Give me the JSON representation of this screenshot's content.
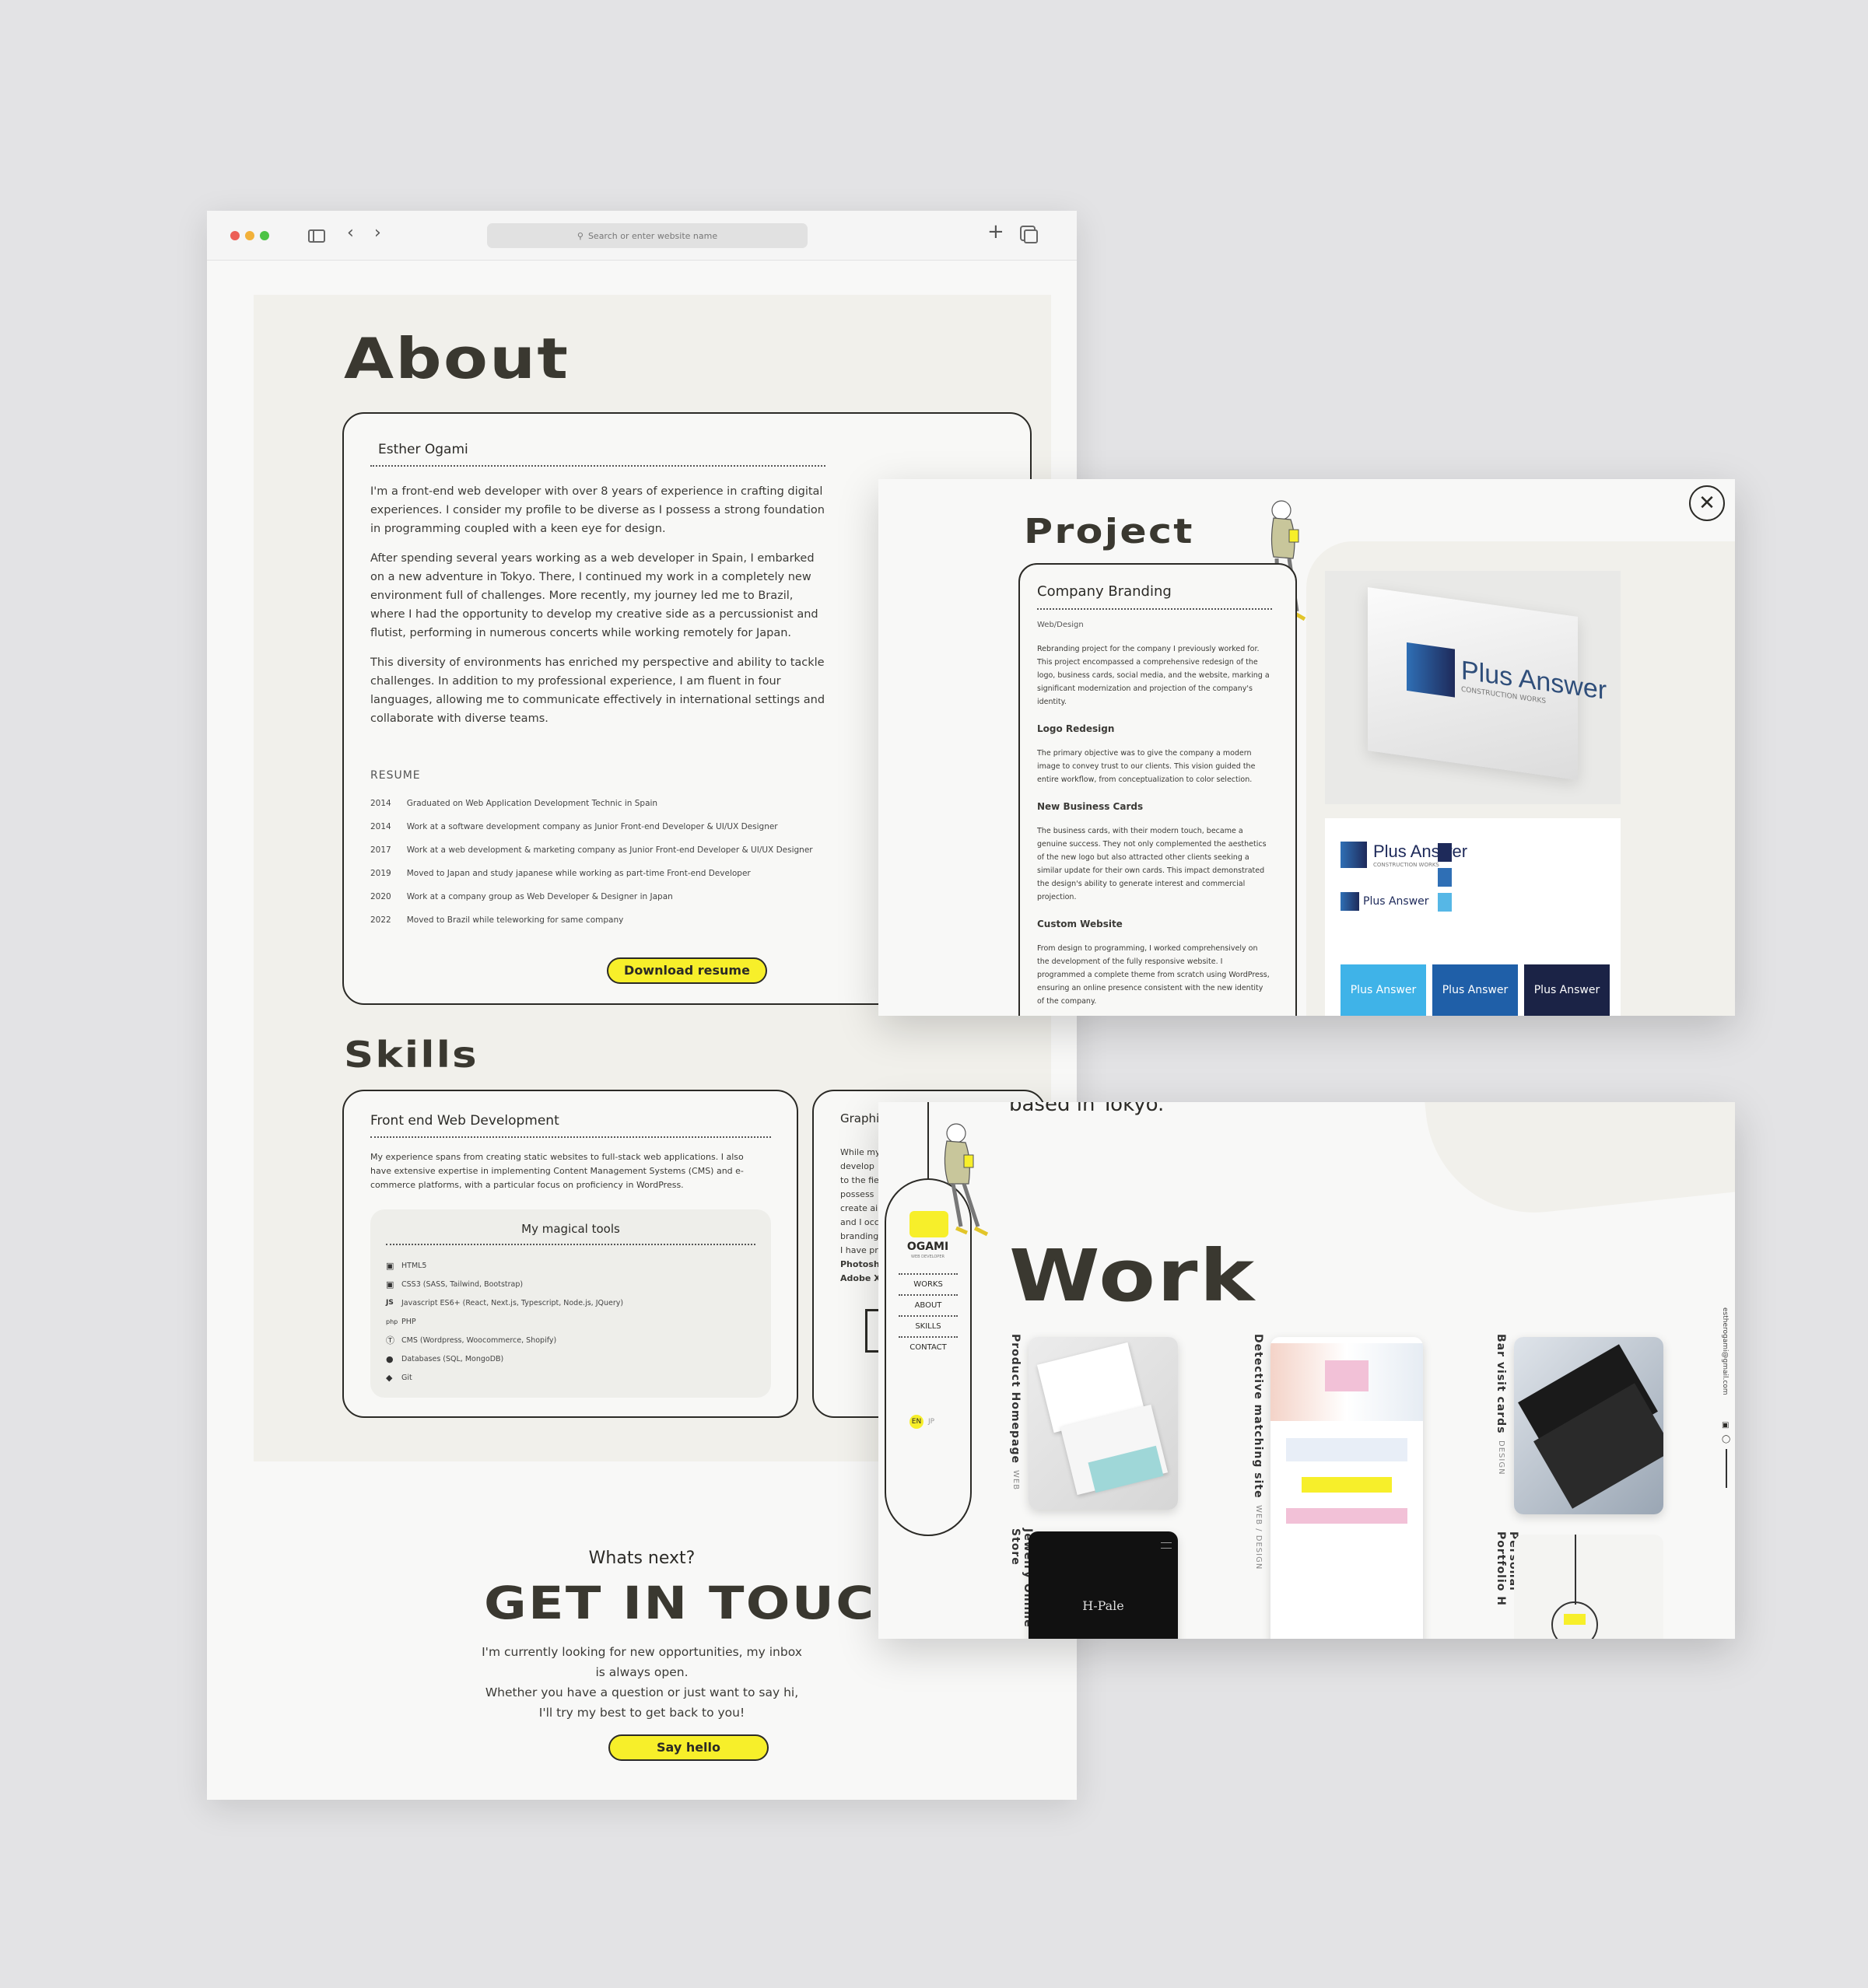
{
  "browser": {
    "address_placeholder": "Search or enter website name"
  },
  "about": {
    "title": "About",
    "name": "Esther Ogami",
    "paragraphs": [
      "I'm a front-end web developer with over 8 years of experience in crafting digital experiences. I consider my profile to be diverse as I possess a strong foundation in programming coupled with a keen eye for design.",
      "After spending several years working as a web developer in Spain, I embarked on a new adventure in Tokyo. There, I continued my work in a completely new environment full of challenges. More recently, my journey led me to Brazil, where I had the opportunity to develop my creative side as a percussionist and flutist, performing in numerous concerts while working remotely for Japan.",
      "This diversity of environments has enriched my perspective and ability to tackle challenges. In addition to my professional experience, I am fluent in four languages, allowing me to communicate effectively in international settings and collaborate with diverse teams."
    ],
    "resume_label": "RESUME",
    "resume": [
      {
        "year": "2014",
        "text": "Graduated on Web Application Development Technic in Spain"
      },
      {
        "year": "2014",
        "text": "Work at a software development company as Junior Front-end Developer & UI/UX Designer"
      },
      {
        "year": "2017",
        "text": "Work at a web development & marketing company as Junior Front-end Developer & UI/UX Designer"
      },
      {
        "year": "2019",
        "text": "Moved to Japan and study japanese while working as part-time Front-end Developer"
      },
      {
        "year": "2020",
        "text": "Work at a company group as Web Developer & Designer in Japan"
      },
      {
        "year": "2022",
        "text": "Moved to Brazil while teleworking for same company"
      }
    ],
    "download_label": "Download resume"
  },
  "skills": {
    "title": "Skills",
    "frontend_title": "Front end Web Development",
    "frontend_text": "My experience spans from creating static websites to full-stack web applications. I also have extensive expertise in implementing Content Management Systems (CMS) and e-commerce platforms, with a particular focus on proficiency in WordPress.",
    "tools_title": "My magical tools",
    "tools": [
      {
        "icon": "html5-icon",
        "label": "HTML5"
      },
      {
        "icon": "css3-icon",
        "label": "CSS3 (SASS, Tailwind, Bootstrap)"
      },
      {
        "icon": "js-icon",
        "label": "Javascript ES6+ (React, Next.js, Typescript, Node.js, JQuery)"
      },
      {
        "icon": "php-icon",
        "label": "PHP"
      },
      {
        "icon": "wordpress-icon",
        "label": "CMS (Wordpress, Woocommerce, Shopify)"
      },
      {
        "icon": "database-icon",
        "label": "Databases (SQL, MongoDB)"
      },
      {
        "icon": "git-icon",
        "label": "Git"
      }
    ],
    "graphic_title": "Graphi",
    "graphic_lines": [
      "While my",
      "develop",
      "to the fie",
      "possess",
      "create ai",
      "and I occ",
      "branding",
      "I have pr",
      "Photosh",
      "Adobe X"
    ]
  },
  "contact": {
    "eyebrow": "Whats next?",
    "title": "GET IN TOUCH",
    "lines": [
      "I'm currently looking for new opportunities, my inbox",
      "is always open.",
      "Whether you have a question or just want to say hi,",
      "I'll try my best to get back to you!"
    ],
    "button": "Say hello"
  },
  "project": {
    "title": "Project",
    "card_title": "Company Branding",
    "category": "Web/Design",
    "intro": "Rebranding project for the company I previously worked for. This project encompassed a comprehensive redesign of the logo, business cards, social media, and the website, marking a significant modernization and projection of the company's identity.",
    "sections": [
      {
        "heading": "Logo Redesign",
        "text": "The primary objective was to give the company a modern image to convey trust to our clients. This vision guided the entire workflow, from conceptualization to color selection."
      },
      {
        "heading": "New Business Cards",
        "text": "The business cards, with their modern touch, became a genuine success. They not only complemented the aesthetics of the new logo but also attracted other clients seeking a similar update for their own cards. This impact demonstrated the design's ability to generate interest and commercial projection."
      },
      {
        "heading": "Custom Website",
        "text": "From design to programming, I worked comprehensively on the development of the fully responsive website. I programmed a complete theme from scratch using WordPress, ensuring an online presence consistent with the new identity of the company."
      }
    ],
    "brand_name": "Plus Answer",
    "brand_sub": "CONSTRUCTION WORKS",
    "swatch_colors": [
      "#1e2a5a",
      "#2f6fb5",
      "#56b7e6"
    ],
    "tile_colors": [
      "#3fb3e8",
      "#1f5fa8",
      "#1b2346"
    ]
  },
  "work": {
    "intro_fragment": "based in Tokyo.",
    "title": "Work",
    "nav": {
      "logo": "OGAMI",
      "logo_sub": "WEB DEVELOPER",
      "items": [
        "WORKS",
        "ABOUT",
        "SKILLS",
        "CONTACT"
      ],
      "lang_active": "EN",
      "lang_other": "JP"
    },
    "items": [
      {
        "title": "Product Homepage",
        "tag": "WEB"
      },
      {
        "title": "Detective matching site",
        "tag": "WEB / DESIGN"
      },
      {
        "title": "Bar visit cards",
        "tag": "DESIGN"
      },
      {
        "title": "Jewelry Online Store",
        "tag": ""
      },
      {
        "title": "Personal Portfolio H",
        "tag": ""
      }
    ],
    "jewelry_logo": "H-Pale",
    "email": "estherogami@gmail.com",
    "accent": "#f7ef2a"
  }
}
